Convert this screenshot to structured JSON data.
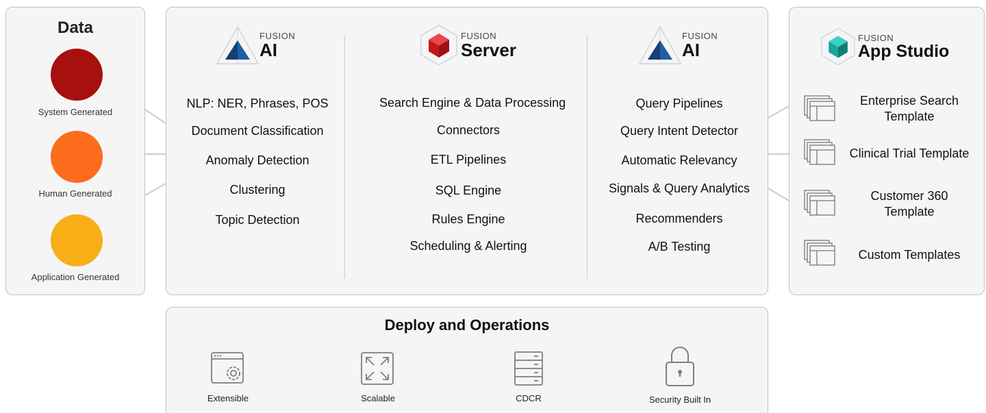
{
  "data_panel": {
    "title": "Data",
    "sources": [
      {
        "label": "System Generated",
        "color": "#a80f0f"
      },
      {
        "label": "Human Generated",
        "color": "#fb6c1c"
      },
      {
        "label": "Application Generated",
        "color": "#f7ae17"
      }
    ]
  },
  "products": {
    "ai_left": {
      "brand": "FUSION",
      "name": "AI"
    },
    "server": {
      "brand": "FUSION",
      "name": "Server"
    },
    "ai_right": {
      "brand": "FUSION",
      "name": "AI"
    },
    "app_studio": {
      "brand": "FUSION",
      "name": "App Studio"
    }
  },
  "ai_left_features": [
    "NLP: NER, Phrases, POS",
    "Document Classification",
    "Anomaly Detection",
    "Clustering",
    "Topic Detection"
  ],
  "server_features": [
    "Search Engine & Data Processing",
    "Connectors",
    "ETL Pipelines",
    "SQL Engine",
    "Rules Engine",
    "Scheduling & Alerting"
  ],
  "ai_right_features": [
    "Query Pipelines",
    "Query Intent Detector",
    "Automatic Relevancy",
    "Signals & Query Analytics",
    "Recommenders",
    "A/B Testing"
  ],
  "templates": [
    {
      "line1": "Enterprise Search",
      "line2": "Template"
    },
    {
      "line1": "Clinical Trial Template",
      "line2": ""
    },
    {
      "line1": "Customer 360",
      "line2": "Template"
    },
    {
      "line1": "Custom Templates",
      "line2": ""
    }
  ],
  "deploy": {
    "title": "Deploy and Operations",
    "items": [
      {
        "label": "Extensible",
        "icon": "browser-gear-icon"
      },
      {
        "label": "Scalable",
        "icon": "expand-arrows-icon"
      },
      {
        "label": "CDCR",
        "icon": "server-rack-icon"
      },
      {
        "label": "Security Built In",
        "icon": "padlock-icon"
      }
    ]
  },
  "colors": {
    "ai_blue": "#1f5fa3",
    "server_red": "#c8161d",
    "studio_teal": "#16a99a"
  }
}
